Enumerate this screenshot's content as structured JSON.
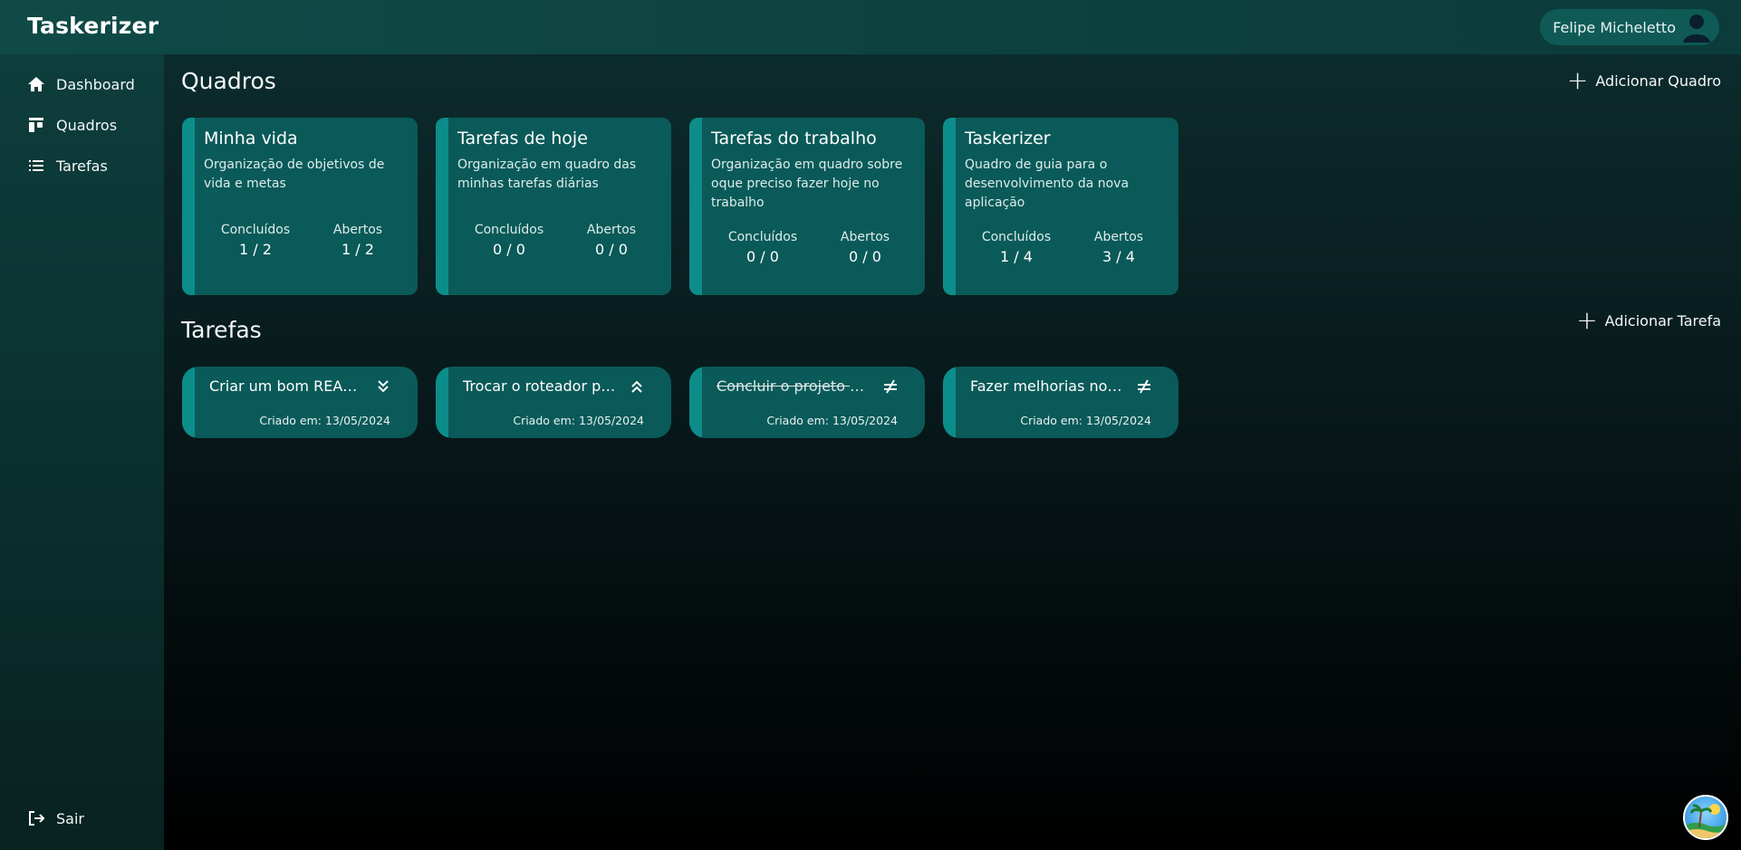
{
  "app": {
    "title": "Taskerizer"
  },
  "user": {
    "name": "Felipe Micheletto"
  },
  "sidebar": {
    "items": [
      {
        "label": "Dashboard",
        "icon": "home-icon"
      },
      {
        "label": "Quadros",
        "icon": "board-icon"
      },
      {
        "label": "Tarefas",
        "icon": "list-icon"
      }
    ],
    "logout_label": "Sair"
  },
  "boards": {
    "title": "Quadros",
    "add_label": "Adicionar Quadro",
    "items": [
      {
        "title": "Minha vida",
        "description": "Organização de objetivos de vida e metas",
        "done_label": "Concluídos",
        "done": "1 / 2",
        "open_label": "Abertos",
        "open": "1 / 2"
      },
      {
        "title": "Tarefas de hoje",
        "description": "Organização em quadro das minhas tarefas diárias",
        "done_label": "Concluídos",
        "done": "0 / 0",
        "open_label": "Abertos",
        "open": "0 / 0"
      },
      {
        "title": "Tarefas do trabalho",
        "description": "Organização em quadro sobre oque preciso fazer hoje no trabalho",
        "done_label": "Concluídos",
        "done": "0 / 0",
        "open_label": "Abertos",
        "open": "0 / 0"
      },
      {
        "title": "Taskerizer",
        "description": "Quadro de guia para o desenvolvimento da nova aplicação",
        "done_label": "Concluídos",
        "done": "1 / 4",
        "open_label": "Abertos",
        "open": "3 / 4"
      }
    ]
  },
  "tasks": {
    "title": "Tarefas",
    "add_label": "Adicionar Tarefa",
    "items": [
      {
        "title": "Criar um bom READ...",
        "priority_icon": "chevrons-down-icon",
        "created": "Criado em: 13/05/2024",
        "done": false
      },
      {
        "title": "Trocar o roteador pa...",
        "priority_icon": "chevrons-up-icon",
        "created": "Criado em: 13/05/2024",
        "done": false
      },
      {
        "title": "Concluir o projeto na...",
        "priority_icon": "not-equal-icon",
        "created": "Criado em: 13/05/2024",
        "done": true
      },
      {
        "title": "Fazer melhorias no p...",
        "priority_icon": "not-equal-icon",
        "created": "Criado em: 13/05/2024",
        "done": false
      }
    ]
  },
  "colors": {
    "card": "#0a5a59",
    "accent_stripe": "#0c8d8a",
    "topbar": "#0f4a47"
  }
}
